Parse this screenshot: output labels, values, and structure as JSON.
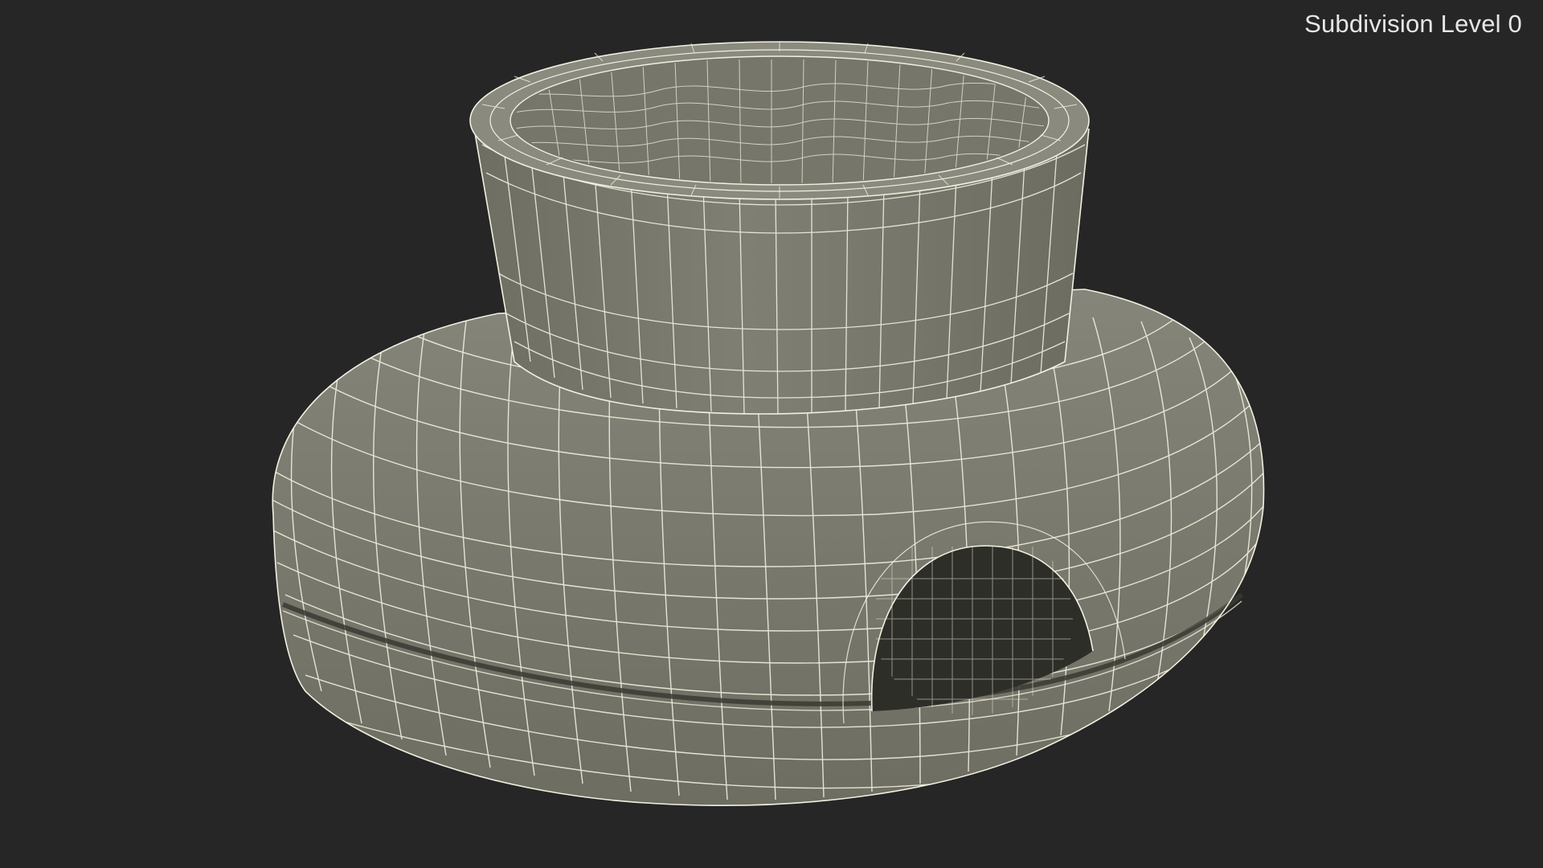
{
  "viewport": {
    "label": "Subdivision Level 0",
    "background_color": "#262626",
    "model_color": "#7a7a6e",
    "wire_color": "#f2f0e0",
    "object": "wireframe-mesh-model"
  }
}
